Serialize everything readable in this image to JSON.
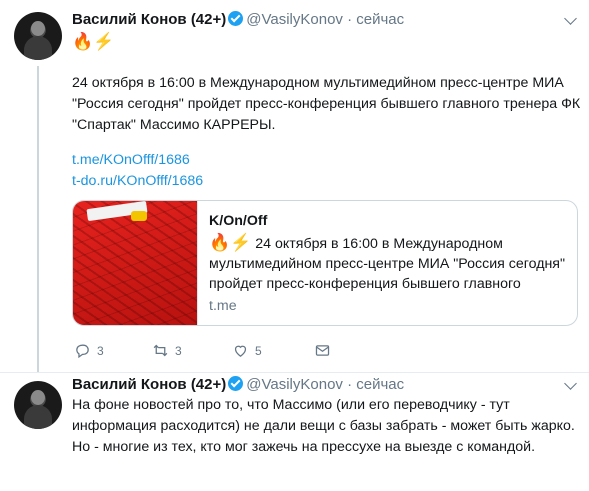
{
  "tweets": [
    {
      "author_name": "Василий Конов",
      "author_badge": "(42+)",
      "handle": "@VasilyKonov",
      "separator": "·",
      "time": "сейчас",
      "emoji": [
        "🔥",
        "⚡"
      ],
      "text": "24 октября в 16:00 в Международном мультимедийном пресс-центре МИА \"Россия сегодня\" пройдет пресс-конференция бывшего главного тренера ФК \"Спартак\" Массимо КАРРЕРЫ.",
      "links": [
        "t.me/KOnOfff/1686",
        "t-do.ru/KOnOfff/1686"
      ],
      "card": {
        "title": "K/On/Off",
        "emoji": [
          "🔥",
          "⚡"
        ],
        "description": "24 октября в 16:00 в Международном мультимедийном пресс-центре МИА \"Россия сегодня\" пройдет пресс-конференция бывшего главного",
        "domain": "t.me"
      },
      "actions": {
        "reply_count": "3",
        "retweet_count": "3",
        "like_count": "5"
      }
    },
    {
      "author_name": "Василий Конов",
      "author_badge": "(42+)",
      "handle": "@VasilyKonov",
      "separator": "·",
      "time": "сейчас",
      "text": "На фоне новостей про то, что Массимо (или его переводчику - тут информация расходится) не дали вещи с базы забрать - может быть жарко. Но - многие из тех, кто мог зажечь на прессухе на выезде с командой."
    }
  ],
  "colors": {
    "accent_link": "#1b95e0",
    "verified": "#1da1f2",
    "muted": "#657786",
    "card_image_red": "#d11b17"
  }
}
